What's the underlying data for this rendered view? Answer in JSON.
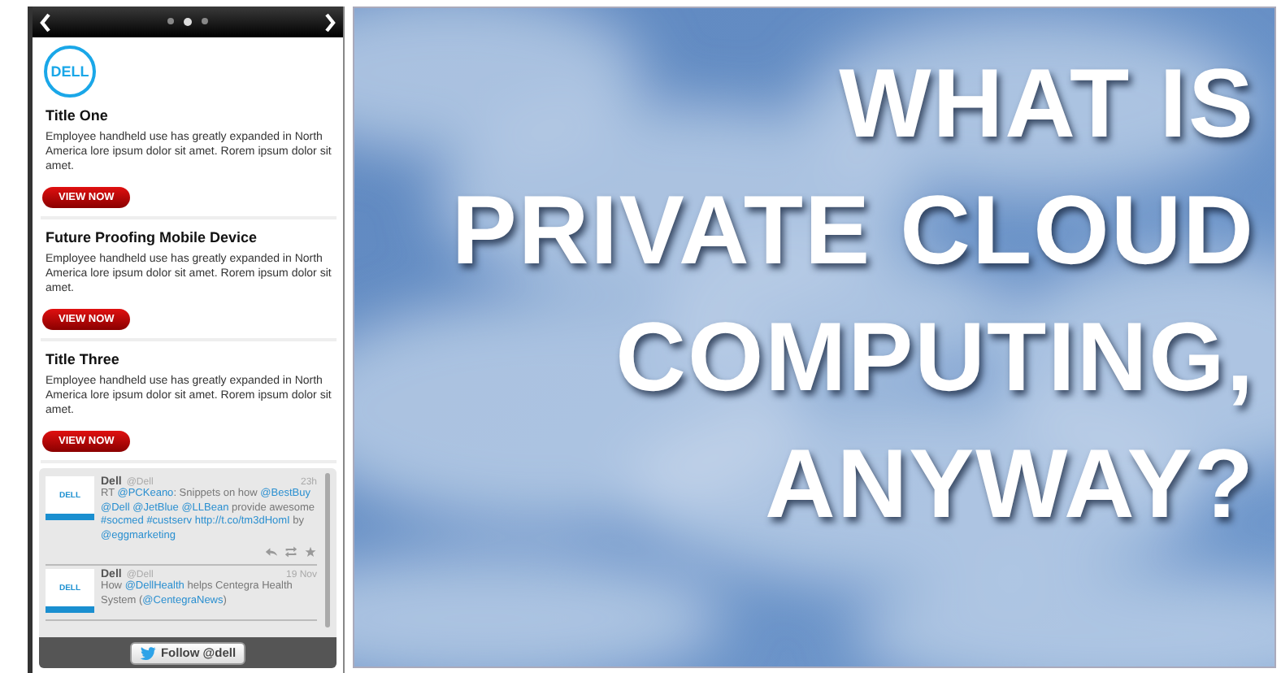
{
  "carousel": {
    "dots": [
      {
        "selected": false
      },
      {
        "selected": true
      },
      {
        "selected": false
      }
    ]
  },
  "logo": "DELL",
  "articles": [
    {
      "title": "Title One",
      "body": "Employee handheld use has greatly expanded in North America lore ipsum dolor sit amet. Rorem ipsum dolor sit amet.",
      "button": "VIEW NOW"
    },
    {
      "title": "Future Proofing Mobile Device",
      "body": "Employee handheld use has greatly expanded in North America lore ipsum dolor sit amet. Rorem ipsum dolor sit amet.",
      "button": "VIEW NOW"
    },
    {
      "title": "Title Three",
      "body": "Employee handheld use has greatly expanded in North America lore ipsum dolor sit amet. Rorem ipsum dolor sit amet.",
      "button": "VIEW NOW"
    }
  ],
  "tweets": [
    {
      "avatar": "DELL",
      "name": "Dell",
      "handle": "@Dell",
      "time": "23h",
      "actions": true,
      "segments": [
        {
          "kind": "plain",
          "text": "RT "
        },
        {
          "kind": "link",
          "text": "@PCKeano"
        },
        {
          "kind": "plain",
          "text": ": Snippets on how "
        },
        {
          "kind": "link",
          "text": "@BestBuy"
        },
        {
          "kind": "link",
          "text": "@Dell"
        },
        {
          "kind": "link",
          "text": "@JetBlue"
        },
        {
          "kind": "link",
          "text": "@LLBean"
        },
        {
          "kind": "plain",
          "text": " provide awesome "
        },
        {
          "kind": "link",
          "text": "#socmed"
        },
        {
          "kind": "link",
          "text": "#custserv"
        },
        {
          "kind": "link",
          "text": "http://t.co/tm3dHomI"
        },
        {
          "kind": "plain",
          "text": " by "
        },
        {
          "kind": "link",
          "text": "@eggmarketing"
        }
      ]
    },
    {
      "avatar": "DELL",
      "name": "Dell",
      "handle": "@Dell",
      "time": "19 Nov",
      "actions": false,
      "segments": [
        {
          "kind": "plain",
          "text": "How "
        },
        {
          "kind": "link",
          "text": "@DellHealth"
        },
        {
          "kind": "plain",
          "text": " helps Centegra Health System ("
        },
        {
          "kind": "link",
          "text": "@CentegraNews"
        },
        {
          "kind": "plain",
          "text": ")"
        }
      ]
    }
  ],
  "follow_button": "Follow @dell",
  "hero": {
    "kind": "picture",
    "headline": [
      "WHAT IS",
      "PRIVATE CLOUD",
      "COMPUTING,",
      "ANYWAY?"
    ]
  }
}
